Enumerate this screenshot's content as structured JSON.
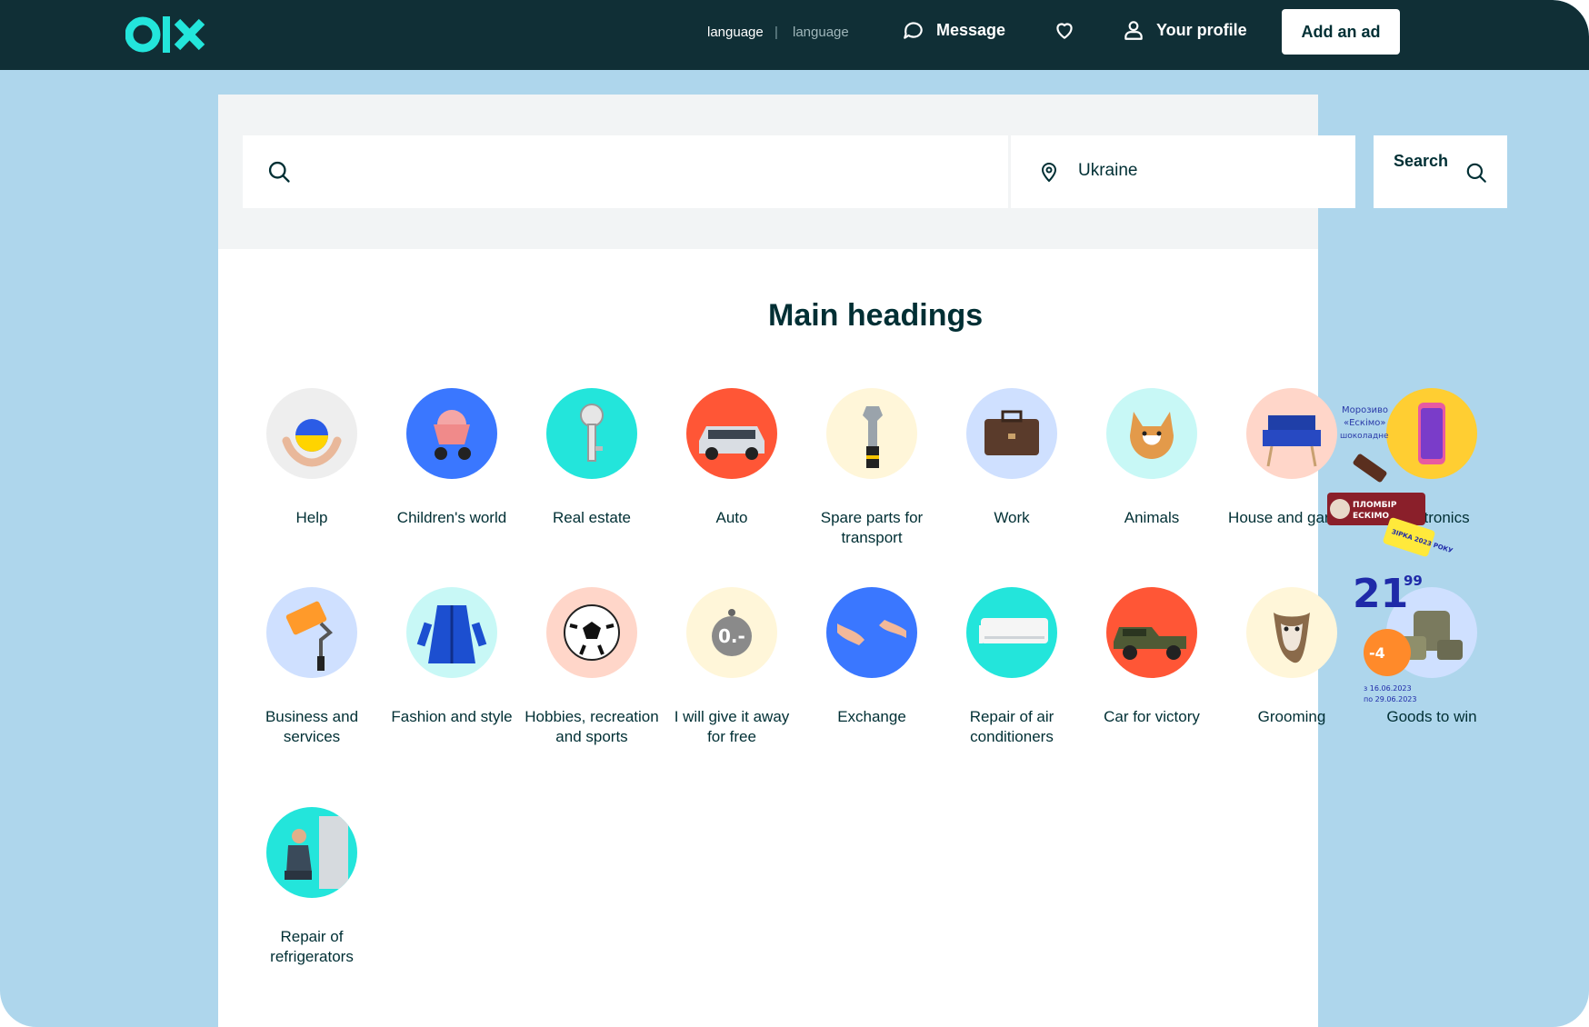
{
  "header": {
    "logo_alt": "olx",
    "language_1": "language",
    "language_sep": "|",
    "language_2": "language",
    "message_label": "Message",
    "profile_label": "Your profile",
    "add_ad_label": "Add an ad"
  },
  "search": {
    "query_value": "",
    "location_value": "Ukraine",
    "button_label": "Search"
  },
  "main": {
    "title": "Main headings",
    "categories": [
      {
        "label": "Help",
        "icon": "hands-heart-icon",
        "bg": "#eeeeee"
      },
      {
        "label": "Children's world",
        "icon": "stroller-icon",
        "bg": "#3a77ff"
      },
      {
        "label": "Real estate",
        "icon": "key-icon",
        "bg": "#23e5db"
      },
      {
        "label": "Auto",
        "icon": "car-icon",
        "bg": "#ff5636"
      },
      {
        "label": "Spare parts for transport",
        "icon": "wrench-icon",
        "bg": "#fff6d9"
      },
      {
        "label": "Work",
        "icon": "briefcase-icon",
        "bg": "#cfe0ff"
      },
      {
        "label": "Animals",
        "icon": "dog-icon",
        "bg": "#c8f8f6"
      },
      {
        "label": "House and garden",
        "icon": "armchair-icon",
        "bg": "#ffd6c9"
      },
      {
        "label": "Electronics",
        "icon": "phone-icon",
        "bg": "#ffce32"
      },
      {
        "label": "Business and services",
        "icon": "paint-roller-icon",
        "bg": "#cfe0ff"
      },
      {
        "label": "Fashion and style",
        "icon": "robe-icon",
        "bg": "#c8f8f6"
      },
      {
        "label": "Hobbies, recreation and sports",
        "icon": "football-icon",
        "bg": "#ffd6c9"
      },
      {
        "label": "I will give it away for free",
        "icon": "price-tag-icon",
        "bg": "#fff6d9"
      },
      {
        "label": "Exchange",
        "icon": "handshake-icon",
        "bg": "#3a77ff"
      },
      {
        "label": "Repair of air conditioners",
        "icon": "air-conditioner-icon",
        "bg": "#23e5db"
      },
      {
        "label": "Car for victory",
        "icon": "pickup-truck-icon",
        "bg": "#ff5636"
      },
      {
        "label": "Grooming",
        "icon": "groomed-dog-icon",
        "bg": "#fff6d9"
      },
      {
        "label": "Goods to win",
        "icon": "military-gear-icon",
        "bg": "#cfe0ff"
      },
      {
        "label": "Repair of refrigerators",
        "icon": "repairman-icon",
        "bg": "#23e5db"
      }
    ]
  },
  "ad_overlay": {
    "line1": "Морозиво",
    "line2": "«Ескімо»",
    "line3": "шоколадне",
    "brand": "ПЛОМБІР",
    "brand2": "ЕСКІМО",
    "price_main": "21",
    "price_cents": "99",
    "discount": "-4",
    "date1": "з 16.06.2023",
    "date2": "по 29.06.2023",
    "tag": "ЗІРКА 2023 РОКУ"
  }
}
